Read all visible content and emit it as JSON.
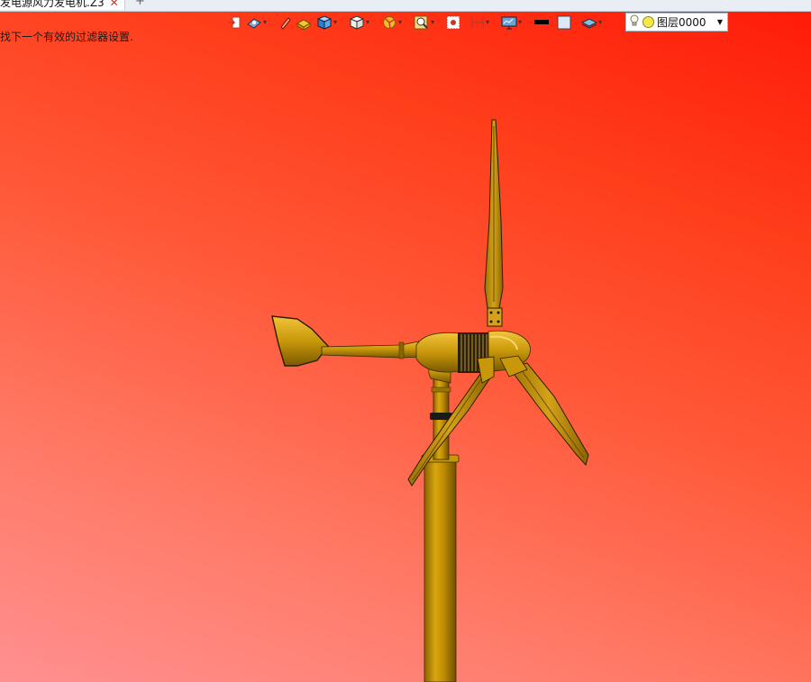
{
  "document": {
    "tab_title": "发电源风力发电机.Z3",
    "close_glyph": "✕",
    "new_tab_glyph": "+"
  },
  "status": {
    "message": "找下一个有效的过滤器设置."
  },
  "toolbar": {
    "icons": [
      "exit-icon",
      "view-icon",
      "pencil-icon",
      "shaded-box-icon",
      "cube-icon",
      "white-cube-icon",
      "render-icon",
      "zoom-icon",
      "fit-icon",
      "section-icon",
      "display-icon",
      "color-swatch-icon",
      "fill-swatch-icon",
      "layer-stack-icon"
    ],
    "layer": {
      "name": "图层0000"
    }
  },
  "colors": {
    "background_top": "#ff1a08",
    "background_bottom": "#ff9090",
    "model_gold": "#c8970a",
    "model_shadow": "#7a5a00"
  }
}
